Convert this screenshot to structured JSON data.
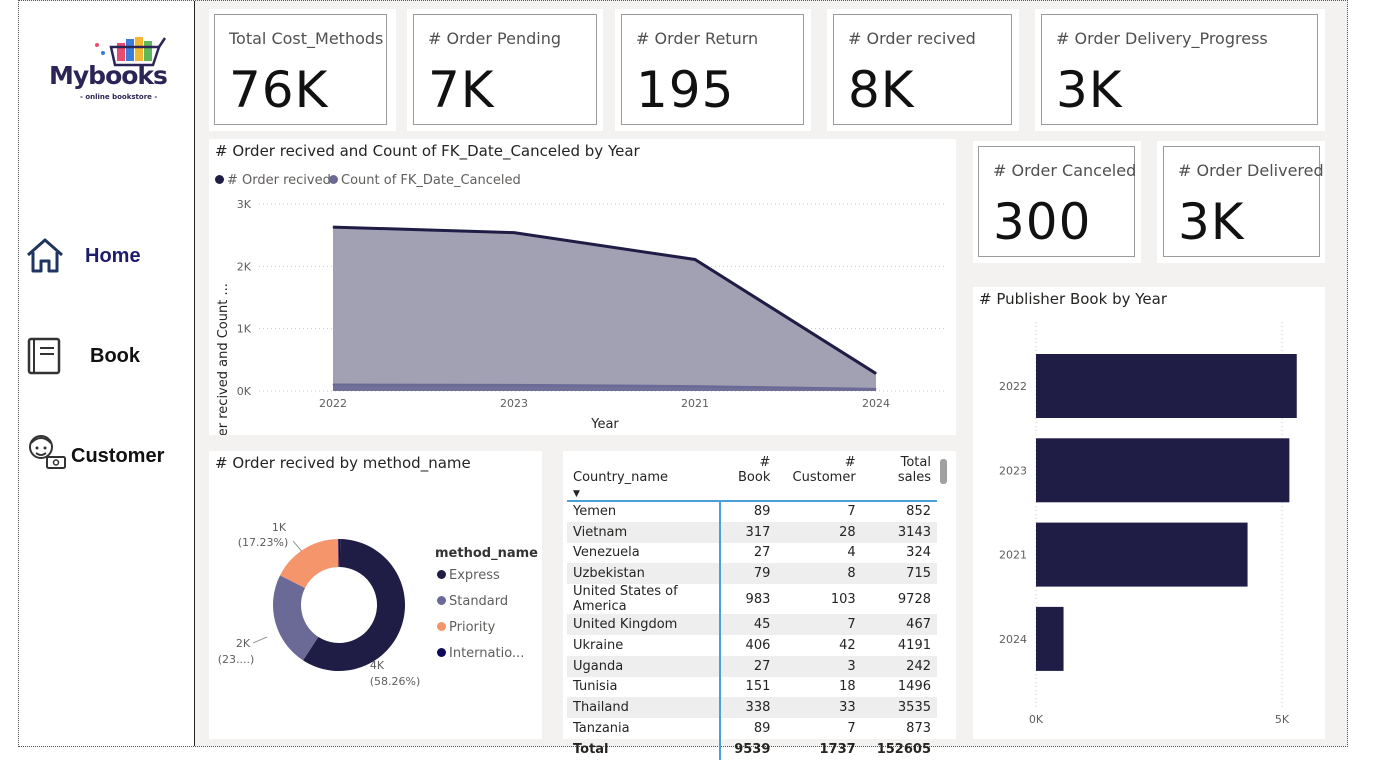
{
  "sidebar": {
    "logo": {
      "word": "Mybooks",
      "tagline": "- online bookstore -"
    },
    "nav": [
      {
        "label": "Home",
        "icon": "home-icon"
      },
      {
        "label": "Book",
        "icon": "book-icon"
      },
      {
        "label": "Customer",
        "icon": "customer-icon"
      }
    ]
  },
  "kpis": {
    "total_cost_methods": {
      "title": "Total Cost_Methods",
      "value": "76K"
    },
    "order_pending": {
      "title": "# Order Pending",
      "value": "7K"
    },
    "order_return": {
      "title": "# Order Return",
      "value": "195"
    },
    "order_received": {
      "title": "# Order recived",
      "value": "8K"
    },
    "order_delivery_progress": {
      "title": "# Order Delivery_Progress",
      "value": "3K"
    },
    "order_canceled": {
      "title": "# Order Canceled",
      "value": "300"
    },
    "order_delivered": {
      "title": "# Order Delivered",
      "value": "3K"
    }
  },
  "colors": {
    "navy": "#1f1c45",
    "purple": "#6b6a96",
    "orange": "#f5956b",
    "deep": "#0f0a5a",
    "area": "#a2a1b4"
  },
  "area_chart": {
    "title": "# Order recived and Count of FK_Date_Canceled by Year",
    "legend": [
      "# Order recived",
      "Count of FK_Date_Canceled"
    ],
    "ylabel": "# Order recived and Count ...",
    "xlabel": "Year",
    "y_ticks": [
      "3K",
      "2K",
      "1K",
      "0K"
    ],
    "chart_data": {
      "type": "area",
      "categories": [
        "2022",
        "2023",
        "2021",
        "2024"
      ],
      "series": [
        {
          "name": "# Order recived",
          "values": [
            2630,
            2540,
            2110,
            280
          ]
        },
        {
          "name": "Count of FK_Date_Canceled",
          "values": [
            100,
            95,
            75,
            30
          ]
        }
      ],
      "ylim": [
        0,
        3000
      ]
    }
  },
  "donut_chart": {
    "title": "# Order recived by method_name",
    "legend_title": "method_name",
    "legend": [
      "Express",
      "Standard",
      "Priority",
      "Internatio..."
    ],
    "labels": {
      "express": {
        "value": "4K",
        "pct": "(58.26%)"
      },
      "standard": {
        "value": "2K",
        "pct": "(23....)"
      },
      "priority": {
        "value": "1K",
        "pct": "(17.23%)"
      }
    },
    "chart_data": {
      "type": "pie",
      "categories": [
        "Express",
        "Standard",
        "Priority",
        "Internatio..."
      ],
      "values": [
        58.26,
        23.0,
        17.23,
        0.5
      ]
    }
  },
  "table": {
    "headers": [
      "Country_name",
      "# Book",
      "# Customer",
      "Total sales"
    ],
    "rows": [
      [
        "Yemen",
        "89",
        "7",
        "852"
      ],
      [
        "Vietnam",
        "317",
        "28",
        "3143"
      ],
      [
        "Venezuela",
        "27",
        "4",
        "324"
      ],
      [
        "Uzbekistan",
        "79",
        "8",
        "715"
      ],
      [
        "United States of America",
        "983",
        "103",
        "9728"
      ],
      [
        "United Kingdom",
        "45",
        "7",
        "467"
      ],
      [
        "Ukraine",
        "406",
        "42",
        "4191"
      ],
      [
        "Uganda",
        "27",
        "3",
        "242"
      ],
      [
        "Tunisia",
        "151",
        "18",
        "1496"
      ],
      [
        "Thailand",
        "338",
        "33",
        "3535"
      ],
      [
        "Tanzania",
        "89",
        "7",
        "873"
      ]
    ],
    "total": [
      "Total",
      "9539",
      "1737",
      "152605"
    ]
  },
  "bar_chart": {
    "title": "# Publisher Book by Year",
    "x_ticks": [
      "0K",
      "5K"
    ],
    "chart_data": {
      "type": "bar",
      "categories": [
        "2022",
        "2023",
        "2021",
        "2024"
      ],
      "values": [
        5300,
        5150,
        4300,
        560
      ],
      "xlim": [
        0,
        5000
      ]
    }
  }
}
